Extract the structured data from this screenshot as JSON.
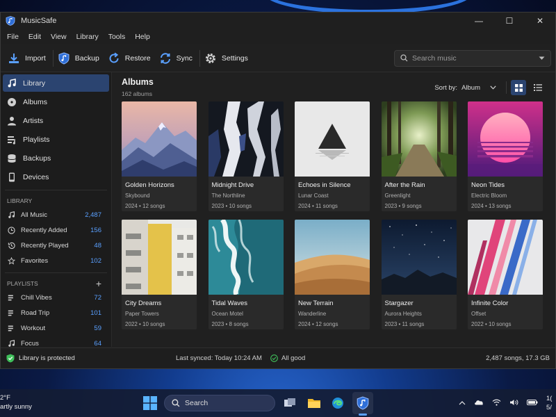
{
  "app": {
    "title": "MusicSafe"
  },
  "window_controls": {
    "minimize": "—",
    "maximize": "☐",
    "close": "✕"
  },
  "menu": [
    "File",
    "Edit",
    "View",
    "Library",
    "Tools",
    "Help"
  ],
  "toolbar": {
    "import": "Import",
    "backup": "Backup",
    "restore": "Restore",
    "sync": "Sync",
    "settings": "Settings",
    "search_placeholder": "Search music"
  },
  "sidebar": {
    "nav": [
      {
        "label": "Library",
        "icon": "music-note-icon",
        "active": true
      },
      {
        "label": "Albums",
        "icon": "disc-icon"
      },
      {
        "label": "Artists",
        "icon": "person-icon"
      },
      {
        "label": "Playlists",
        "icon": "playlist-icon"
      },
      {
        "label": "Backups",
        "icon": "database-icon"
      },
      {
        "label": "Devices",
        "icon": "phone-icon"
      }
    ],
    "library_heading": "LIBRARY",
    "library_items": [
      {
        "label": "All Music",
        "count": "2,487",
        "icon": "music-note-icon"
      },
      {
        "label": "Recently Added",
        "count": "156",
        "icon": "clock-icon"
      },
      {
        "label": "Recently Played",
        "count": "48",
        "icon": "history-icon"
      },
      {
        "label": "Favorites",
        "count": "102",
        "icon": "star-icon"
      }
    ],
    "playlists_heading": "PLAYLISTS",
    "playlists_add": "+",
    "playlists": [
      {
        "label": "Chill Vibes",
        "count": "72"
      },
      {
        "label": "Road Trip",
        "count": "101"
      },
      {
        "label": "Workout",
        "count": "59"
      },
      {
        "label": "Focus",
        "count": "64"
      }
    ]
  },
  "main": {
    "title": "Albums",
    "subtitle": "162 albums",
    "sort_label": "Sort by:",
    "sort_value": "Album",
    "albums": [
      {
        "title": "Golden Horizons",
        "artist": "Skybound",
        "meta": "2024 • 12 songs",
        "art": "mountains"
      },
      {
        "title": "Midnight Drive",
        "artist": "The Northline",
        "meta": "2023 • 10 songs",
        "art": "abstract-dark"
      },
      {
        "title": "Echoes in Silence",
        "artist": "Lunar Coast",
        "meta": "2024 • 11 songs",
        "art": "triangle"
      },
      {
        "title": "After the Rain",
        "artist": "Greenlight",
        "meta": "2023 • 9 songs",
        "art": "forest"
      },
      {
        "title": "Neon Tides",
        "artist": "Electric Bloom",
        "meta": "2024 • 13 songs",
        "art": "sunset"
      },
      {
        "title": "City Dreams",
        "artist": "Paper Towers",
        "meta": "2022 • 10 songs",
        "art": "building"
      },
      {
        "title": "Tidal Waves",
        "artist": "Ocean Motel",
        "meta": "2023 • 8 songs",
        "art": "waves"
      },
      {
        "title": "New Terrain",
        "artist": "Wanderline",
        "meta": "2024 • 12 songs",
        "art": "dunes"
      },
      {
        "title": "Stargazer",
        "artist": "Aurora Heights",
        "meta": "2023 • 11 songs",
        "art": "stars"
      },
      {
        "title": "Infinite Color",
        "artist": "Offset",
        "meta": "2022 • 10 songs",
        "art": "paint"
      }
    ]
  },
  "status": {
    "protected": "Library is protected",
    "last_synced": "Last synced: Today 10:24 AM",
    "all_good": "All good",
    "summary": "2,487 songs, 17.3 GB"
  },
  "taskbar": {
    "weather_temp": "2°F",
    "weather_desc": "artly sunny",
    "search_label": "Search",
    "clock_time": "1(",
    "clock_date": "5/"
  },
  "colors": {
    "accent": "#2b4470",
    "count_blue": "#5aa0ff",
    "good_green": "#3fbf5a"
  }
}
